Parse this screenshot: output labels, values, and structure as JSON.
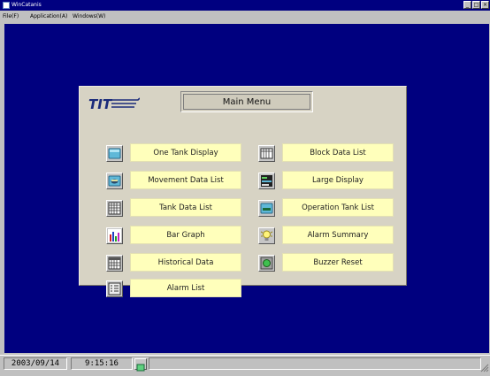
{
  "window": {
    "title": "WinCatanis",
    "buttons": {
      "minimize": "_",
      "maximize": "□",
      "close": "×"
    }
  },
  "menubar": {
    "items": [
      {
        "label": "File(F)"
      },
      {
        "label": "Application(A)"
      },
      {
        "label": "Windows(W)"
      }
    ]
  },
  "panel": {
    "logo": "TIT",
    "header": "Main Menu",
    "left_items": [
      {
        "label": "One Tank Display",
        "icon": "tank-icon"
      },
      {
        "label": "Movement Data List",
        "icon": "movement-icon"
      },
      {
        "label": "Tank Data List",
        "icon": "grid-icon"
      },
      {
        "label": "Bar Graph",
        "icon": "bar-chart-icon"
      },
      {
        "label": "Historical Data",
        "icon": "calendar-icon"
      },
      {
        "label": "Alarm List",
        "icon": "list-icon"
      }
    ],
    "right_items": [
      {
        "label": "Block Data List",
        "icon": "block-data-icon"
      },
      {
        "label": "Large Display",
        "icon": "large-display-icon"
      },
      {
        "label": "Operation Tank List",
        "icon": "operation-tank-icon"
      },
      {
        "label": "Alarm Summary",
        "icon": "bulb-icon"
      },
      {
        "label": "Buzzer Reset",
        "icon": "buzzer-icon"
      }
    ]
  },
  "statusbar": {
    "date": "2003/09/14",
    "time": "9:15:16",
    "icon": "status-tank-icon"
  },
  "colors": {
    "workspace": "#00007f",
    "titlebar": "#000080",
    "button_face": "#ffffbb",
    "panel": "#d7d3c4"
  }
}
